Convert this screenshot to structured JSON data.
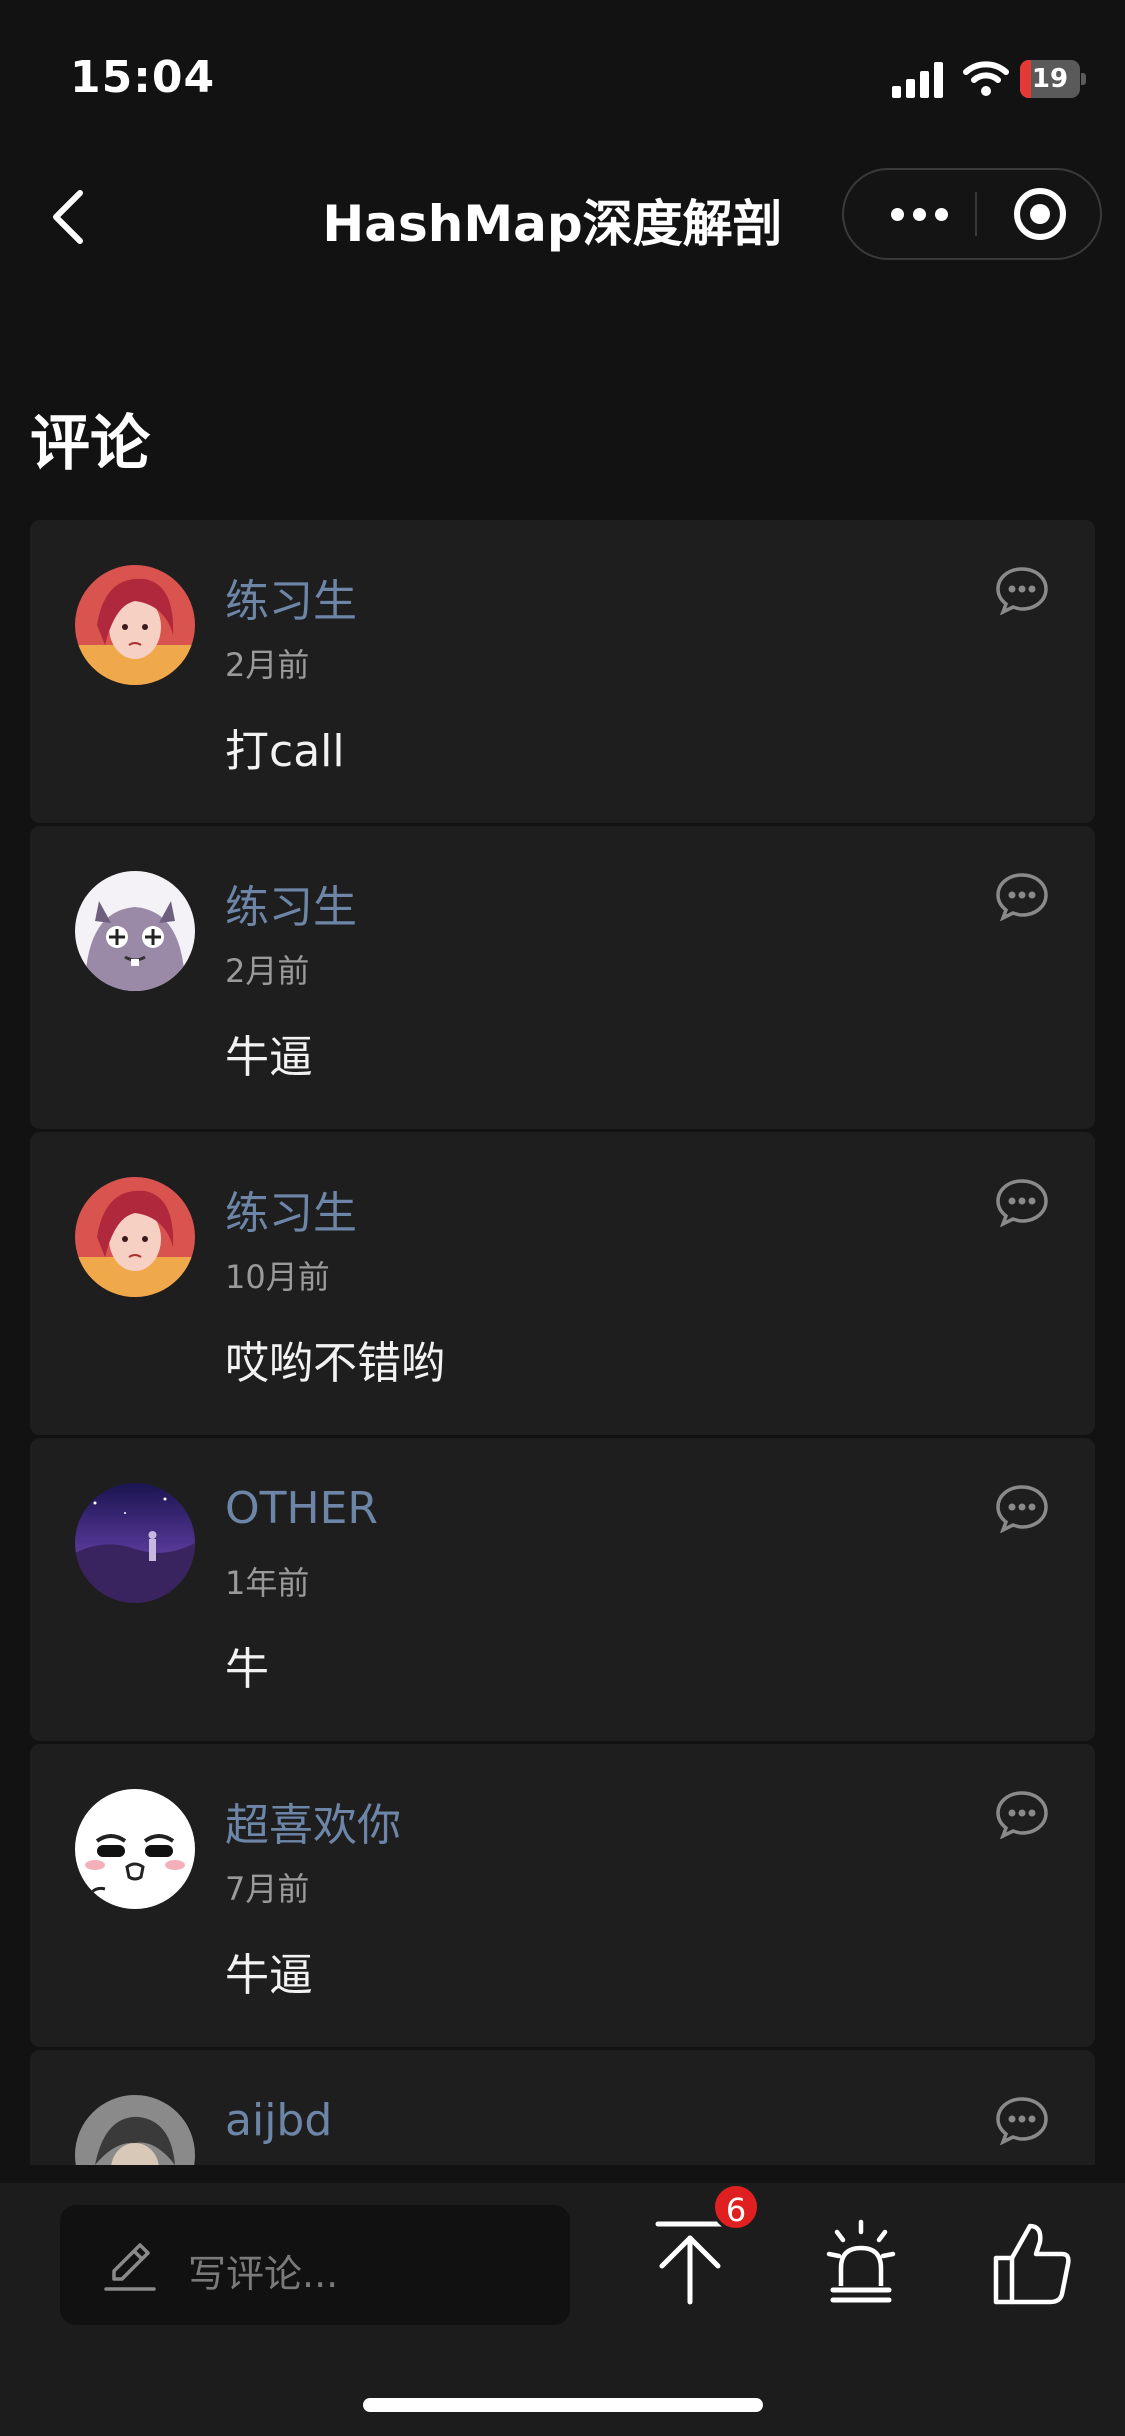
{
  "status_bar": {
    "time": "15:04",
    "battery": 19,
    "battery_label": "19"
  },
  "nav": {
    "title": "HashMap深度解剖"
  },
  "section": {
    "title": "评论"
  },
  "comments": [
    {
      "username": "练习生",
      "time": "2月前",
      "content": "打call",
      "avatar": "girl-pink-hair-avatar"
    },
    {
      "username": "练习生",
      "time": "2月前",
      "content": "牛逼",
      "avatar": "purple-cartoon-creature-avatar"
    },
    {
      "username": "练习生",
      "time": "10月前",
      "content": "哎哟不错哟",
      "avatar": "girl-pink-hair-avatar"
    },
    {
      "username": "OTHER",
      "time": "1年前",
      "content": "牛",
      "avatar": "purple-night-sky-avatar"
    },
    {
      "username": "超喜欢你",
      "time": "7月前",
      "content": "牛逼",
      "avatar": "white-meme-face-avatar"
    },
    {
      "username": "aijbd",
      "time": "",
      "content": "",
      "avatar": "gray-character-avatar"
    }
  ],
  "bottom_bar": {
    "input_placeholder": "写评论...",
    "share_badge": "6"
  },
  "colors": {
    "background": "#121212",
    "card": "#1e1e1e",
    "username": "#6d86a8",
    "badge": "#e02020"
  }
}
